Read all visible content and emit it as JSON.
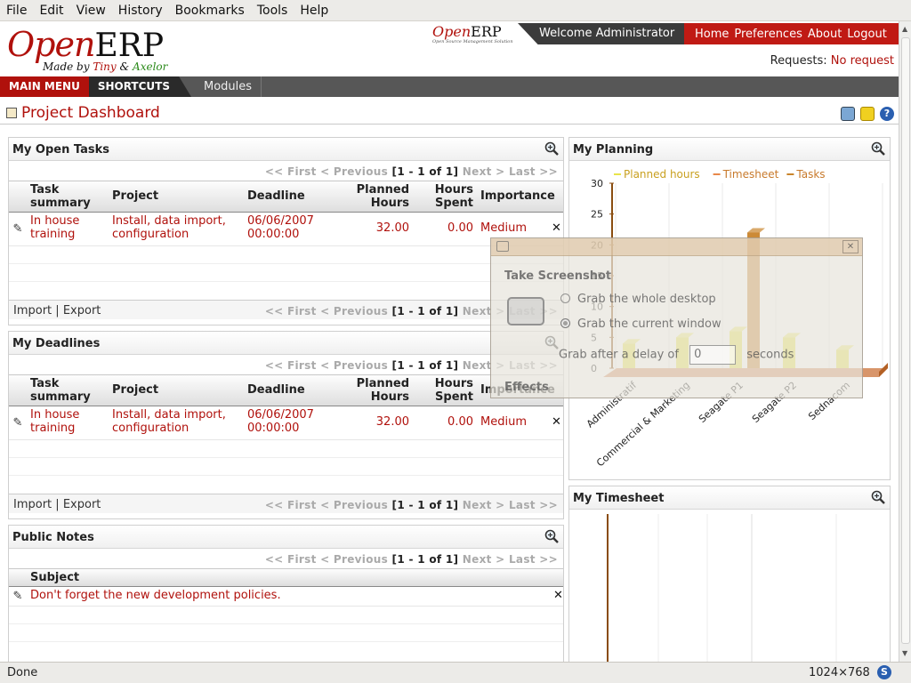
{
  "browser": {
    "menu": [
      "File",
      "Edit",
      "View",
      "History",
      "Bookmarks",
      "Tools",
      "Help"
    ],
    "status": "Done",
    "resolution": "1024x768"
  },
  "header": {
    "logo_open": "Open",
    "logo_erp": "ERP",
    "logo_made": "Made by",
    "logo_tiny": "Tiny",
    "logo_and": "&",
    "logo_axelor": "Axelor",
    "small_logo_open": "Open",
    "small_logo_erp": "ERP",
    "small_logo_tag": "Open Source Management Solution",
    "welcome": "Welcome Administrator",
    "links": [
      "Home",
      "Preferences",
      "About",
      "Logout"
    ],
    "requests_label": "Requests:",
    "requests_value": "No request"
  },
  "nav": {
    "main_menu": "MAIN MENU",
    "shortcuts": "SHORTCUTS",
    "modules": "Modules"
  },
  "page": {
    "title": "Project Dashboard"
  },
  "pager": {
    "first": "<< First",
    "previous": "< Previous",
    "range": "[1 - 1 of 1]",
    "next": "Next >",
    "last": "Last >>"
  },
  "footer_links": {
    "import": "Import",
    "sep": "|",
    "export": "Export"
  },
  "open_tasks": {
    "title": "My Open Tasks",
    "columns": [
      "Task summary",
      "Project",
      "Deadline",
      "Planned Hours",
      "Hours Spent",
      "Importance"
    ],
    "rows": [
      {
        "task": "In house training",
        "project": "Install, data import, configuration",
        "deadline": "06/06/2007 00:00:00",
        "planned": "32.00",
        "spent": "0.00",
        "importance": "Medium"
      }
    ]
  },
  "deadlines": {
    "title": "My Deadlines",
    "columns": [
      "Task summary",
      "Project",
      "Deadline",
      "Planned Hours",
      "Hours Spent",
      "Importance"
    ],
    "rows": [
      {
        "task": "In house training",
        "project": "Install, data import, configuration",
        "deadline": "06/06/2007 00:00:00",
        "planned": "32.00",
        "spent": "0.00",
        "importance": "Medium"
      }
    ]
  },
  "notes": {
    "title": "Public Notes",
    "columns": [
      "Subject"
    ],
    "rows": [
      {
        "subject": "Don't forget the new development policies."
      }
    ]
  },
  "planning": {
    "title": "My Planning"
  },
  "timesheet": {
    "title": "My Timesheet"
  },
  "chart_data": {
    "type": "bar",
    "categories": [
      "Administratif",
      "Commercial & Marketing",
      "Seagate P1",
      "Seagate P2",
      "Sednacom"
    ],
    "series": [
      {
        "name": "Planned hours",
        "values": [
          4,
          5,
          6,
          5,
          3
        ],
        "color": "#e8e44a"
      },
      {
        "name": "Timesheet",
        "values": [
          0,
          0,
          0,
          0,
          0
        ],
        "color": "#e8884a"
      },
      {
        "name": "Tasks",
        "values": [
          0,
          0,
          22,
          0,
          0
        ],
        "color": "#c9842c"
      }
    ],
    "ylim": [
      0,
      30
    ],
    "yticks": [
      0,
      5,
      10,
      15,
      20,
      25,
      30
    ],
    "legend": "top",
    "grid": true
  },
  "screenshot_dialog": {
    "title": "Take Screenshot",
    "option_desktop": "Grab the whole desktop",
    "option_window": "Grab the current window",
    "delay_label": "Grab after a delay of",
    "delay_value": "0",
    "delay_unit": "seconds",
    "effects": "Effects"
  }
}
